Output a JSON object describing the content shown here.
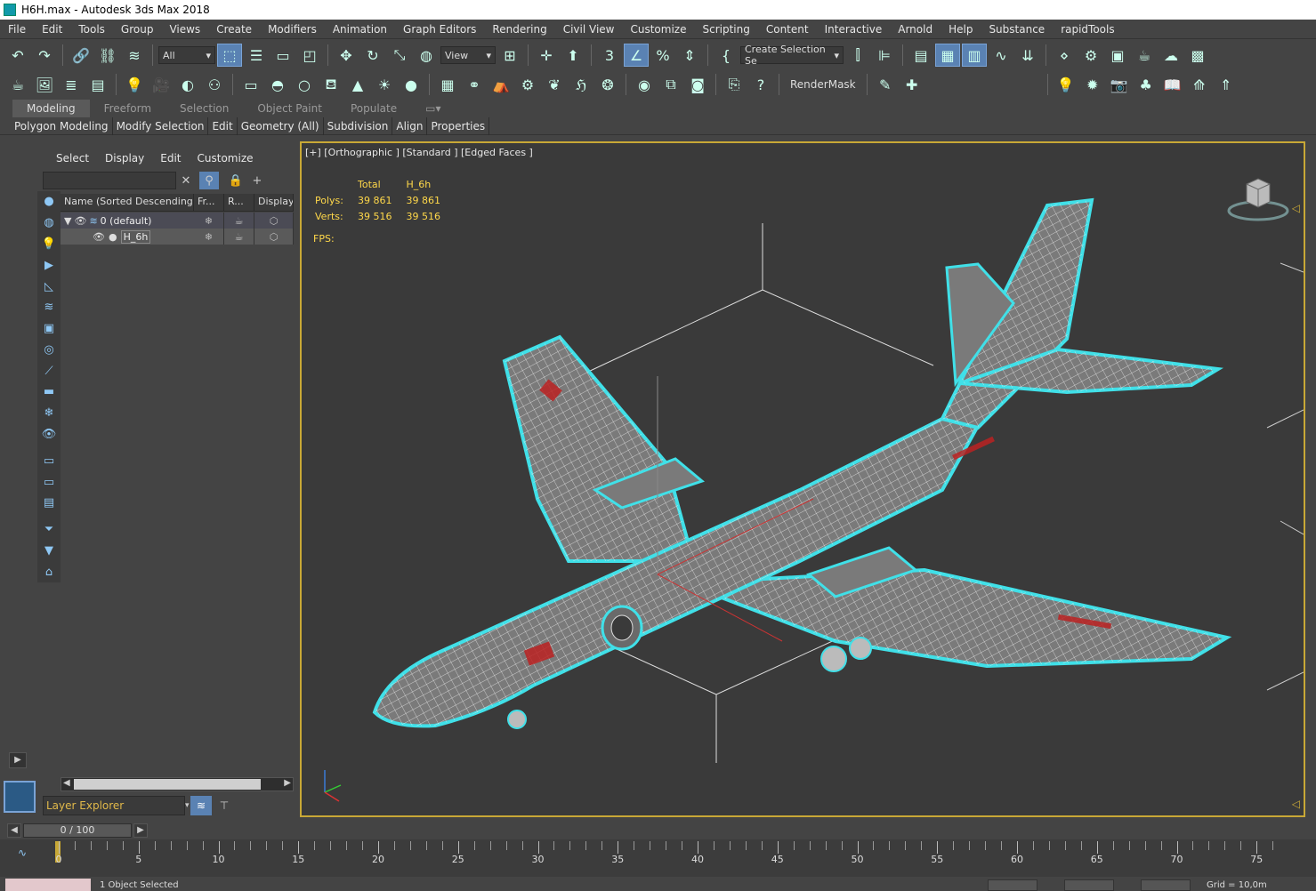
{
  "window": {
    "title": "H6H.max - Autodesk 3ds Max 2018"
  },
  "menus": [
    "File",
    "Edit",
    "Tools",
    "Group",
    "Views",
    "Create",
    "Modifiers",
    "Animation",
    "Graph Editors",
    "Rendering",
    "Civil View",
    "Customize",
    "Scripting",
    "Content",
    "Interactive",
    "Arnold",
    "Help",
    "Substance",
    "rapidTools"
  ],
  "toolbar": {
    "filter_dropdown": "All",
    "refcoord_dropdown": "View",
    "selection_set": "Create Selection Se",
    "rendermask_label": "RenderMask"
  },
  "ribbon": {
    "tabs": [
      "Modeling",
      "Freeform",
      "Selection",
      "Object Paint",
      "Populate"
    ],
    "subtabs": [
      "Polygon Modeling",
      "Modify Selection",
      "Edit",
      "Geometry (All)",
      "Subdivision",
      "Align",
      "Properties"
    ]
  },
  "scene_explorer": {
    "menus": [
      "Select",
      "Display",
      "Edit",
      "Customize"
    ],
    "columns": [
      "Name (Sorted Descending)",
      "Fr...",
      "R...",
      "Display a"
    ],
    "rows": [
      {
        "name": "0 (default)"
      },
      {
        "name": "H_6h"
      }
    ],
    "layer_dropdown": "Layer Explorer"
  },
  "viewport": {
    "label": "[+] [Orthographic ] [Standard ] [Edged Faces ]",
    "stats": {
      "headers": [
        "Total",
        "H_6h"
      ],
      "polys_label": "Polys:",
      "polys_total": "39 861",
      "polys_obj": "39 861",
      "verts_label": "Verts:",
      "verts_total": "39 516",
      "verts_obj": "39 516"
    },
    "fps_label": "FPS:"
  },
  "timeline": {
    "slider_text": "0 / 100",
    "ticks": [
      0,
      5,
      10,
      15,
      20,
      25,
      30,
      35,
      40,
      45,
      50,
      55,
      60,
      65,
      70,
      75
    ]
  },
  "status": {
    "selection_text": "1 Object Selected",
    "grid_text": "Grid = 10,0m"
  },
  "colors": {
    "accent": "#5a82b3",
    "viewport_border": "#c8a836",
    "selection_outline": "#40e0e8",
    "stats_text": "#ffd84a"
  }
}
